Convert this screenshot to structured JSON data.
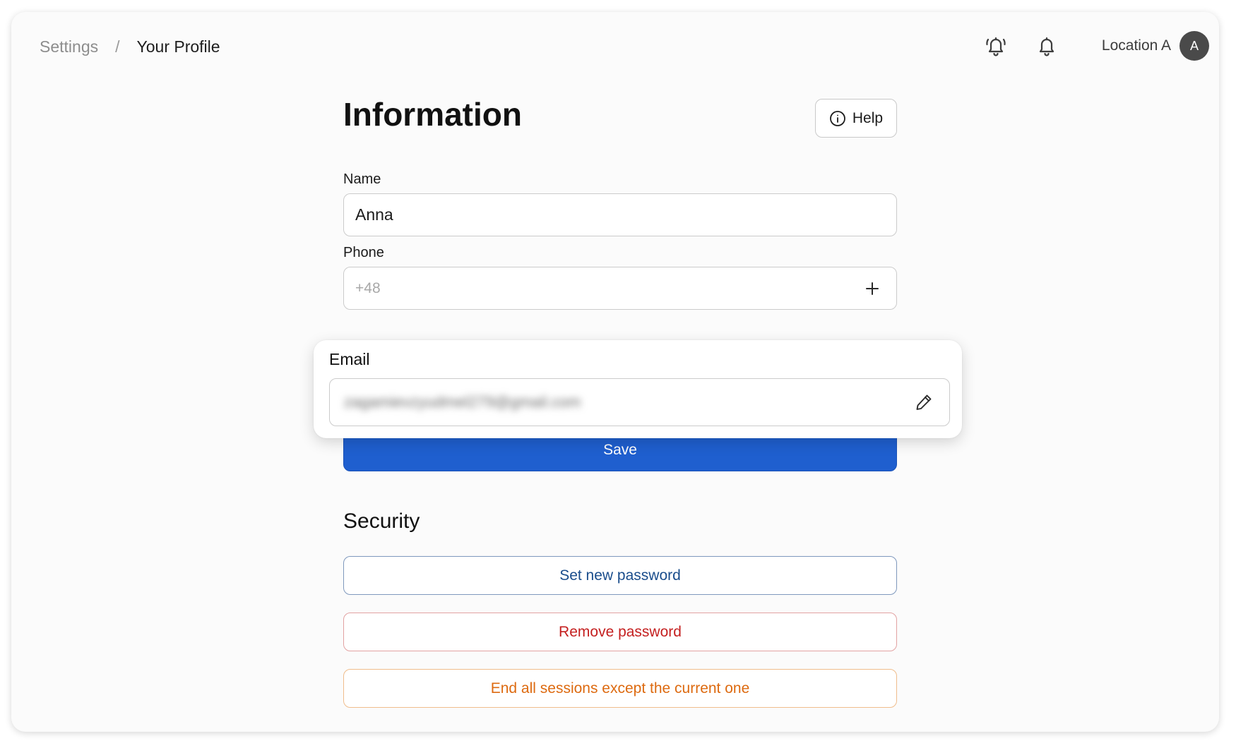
{
  "breadcrumb": {
    "root": "Settings",
    "separator": "/",
    "current": "Your Profile"
  },
  "topbar": {
    "icons": [
      "alarm-bell-icon",
      "bell-icon"
    ],
    "location": "Location A",
    "avatar_initial": "A"
  },
  "information": {
    "title": "Information",
    "help_label": "Help",
    "help_icon": "info-circle-icon"
  },
  "fields": {
    "name": {
      "label": "Name",
      "value": "Anna"
    },
    "phone": {
      "label": "Phone",
      "placeholder": "+48",
      "action_icon": "plus-icon"
    },
    "email": {
      "label": "Email",
      "value": "zagamievzyudmel279@gmail.com",
      "action_icon": "pencil-icon"
    }
  },
  "save_label": "Save",
  "security": {
    "title": "Security",
    "set_password_label": "Set new password",
    "remove_password_label": "Remove password",
    "end_sessions_label": "End all sessions except the current one"
  },
  "colors": {
    "primary": "#1f5fcf",
    "set_password": "#1a4d8c",
    "remove_password": "#c41f1f",
    "end_sessions": "#dd6a10"
  }
}
